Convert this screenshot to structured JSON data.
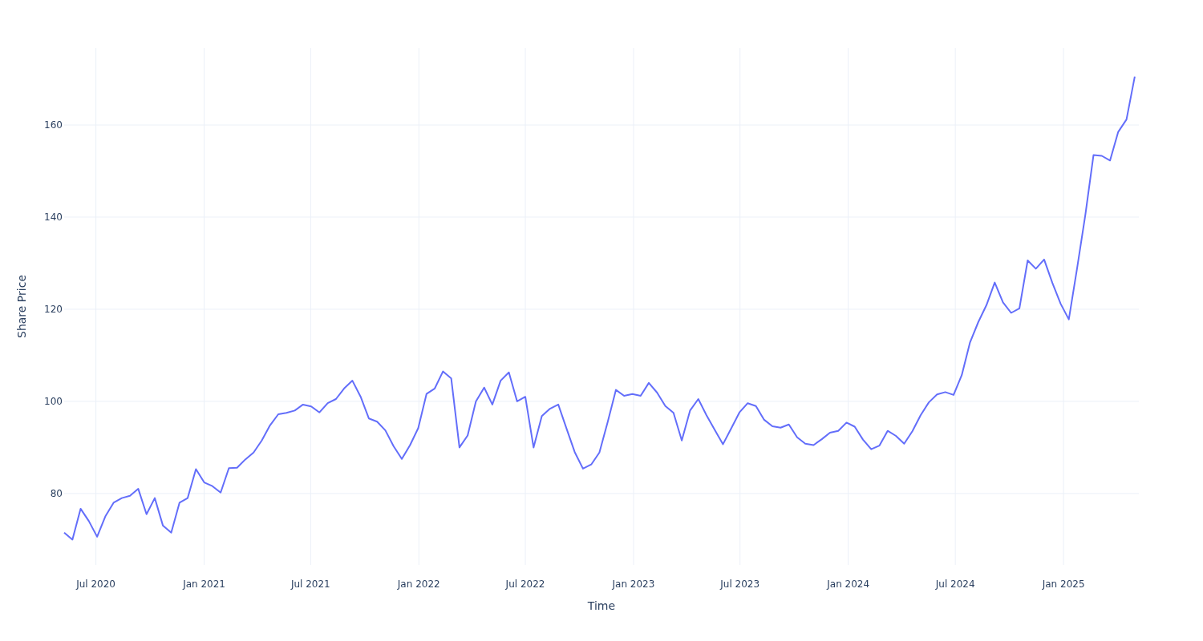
{
  "chart": {
    "chart_data": {
      "type": "line",
      "xlabel": "Time",
      "ylabel": "Share Price",
      "grid": true,
      "xlim": [
        "2020-05-08",
        "2025-05-09"
      ],
      "ylim": [
        64.5,
        176.7
      ],
      "xticks": [
        {
          "value": "2020-07-01",
          "label": "Jul 2020"
        },
        {
          "value": "2021-01-01",
          "label": "Jan 2021"
        },
        {
          "value": "2021-07-01",
          "label": "Jul 2021"
        },
        {
          "value": "2022-01-01",
          "label": "Jan 2022"
        },
        {
          "value": "2022-07-01",
          "label": "Jul 2022"
        },
        {
          "value": "2023-01-01",
          "label": "Jan 2023"
        },
        {
          "value": "2023-07-01",
          "label": "Jul 2023"
        },
        {
          "value": "2024-01-01",
          "label": "Jan 2024"
        },
        {
          "value": "2024-07-01",
          "label": "Jul 2024"
        },
        {
          "value": "2025-01-01",
          "label": "Jan 2025"
        }
      ],
      "yticks": [
        80,
        100,
        120,
        140,
        160
      ],
      "x": [
        "2020-05-08",
        "2020-05-22",
        "2020-06-05",
        "2020-06-19",
        "2020-07-03",
        "2020-07-17",
        "2020-07-31",
        "2020-08-14",
        "2020-08-28",
        "2020-09-11",
        "2020-09-25",
        "2020-10-09",
        "2020-10-23",
        "2020-11-06",
        "2020-11-20",
        "2020-12-04",
        "2020-12-18",
        "2021-01-01",
        "2021-01-15",
        "2021-01-29",
        "2021-02-12",
        "2021-02-26",
        "2021-03-12",
        "2021-03-26",
        "2021-04-09",
        "2021-04-23",
        "2021-05-07",
        "2021-05-21",
        "2021-06-04",
        "2021-06-18",
        "2021-07-02",
        "2021-07-16",
        "2021-07-30",
        "2021-08-13",
        "2021-08-27",
        "2021-09-10",
        "2021-09-24",
        "2021-10-08",
        "2021-10-22",
        "2021-11-05",
        "2021-11-19",
        "2021-12-03",
        "2021-12-17",
        "2021-12-31",
        "2022-01-14",
        "2022-01-28",
        "2022-02-11",
        "2022-02-25",
        "2022-03-11",
        "2022-03-25",
        "2022-04-08",
        "2022-04-22",
        "2022-05-06",
        "2022-05-20",
        "2022-06-03",
        "2022-06-17",
        "2022-07-01",
        "2022-07-15",
        "2022-07-29",
        "2022-08-12",
        "2022-08-26",
        "2022-09-09",
        "2022-09-23",
        "2022-10-07",
        "2022-10-21",
        "2022-11-04",
        "2022-11-18",
        "2022-12-02",
        "2022-12-16",
        "2022-12-30",
        "2023-01-13",
        "2023-01-27",
        "2023-02-10",
        "2023-02-24",
        "2023-03-10",
        "2023-03-24",
        "2023-04-07",
        "2023-04-21",
        "2023-05-05",
        "2023-05-19",
        "2023-06-02",
        "2023-06-16",
        "2023-06-30",
        "2023-07-14",
        "2023-07-28",
        "2023-08-11",
        "2023-08-25",
        "2023-09-08",
        "2023-09-22",
        "2023-10-06",
        "2023-10-20",
        "2023-11-03",
        "2023-11-17",
        "2023-12-01",
        "2023-12-15",
        "2023-12-29",
        "2024-01-12",
        "2024-01-26",
        "2024-02-09",
        "2024-02-23",
        "2024-03-08",
        "2024-03-22",
        "2024-04-05",
        "2024-04-19",
        "2024-05-03",
        "2024-05-17",
        "2024-05-31",
        "2024-06-14",
        "2024-06-28",
        "2024-07-12",
        "2024-07-26",
        "2024-08-09",
        "2024-08-23",
        "2024-09-06",
        "2024-09-20",
        "2024-10-04",
        "2024-10-18",
        "2024-11-01",
        "2024-11-15",
        "2024-11-29",
        "2024-12-13",
        "2024-12-27",
        "2025-01-10",
        "2025-01-24",
        "2025-02-07",
        "2025-02-21",
        "2025-03-07",
        "2025-03-21",
        "2025-04-04",
        "2025-04-18",
        "2025-05-02"
      ],
      "series": [
        {
          "color": "#636efa",
          "values": [
            71.5,
            70,
            76.7,
            74,
            70.6,
            75,
            78,
            79,
            79.5,
            81,
            75.5,
            79,
            73,
            71.5,
            78,
            79,
            85.3,
            82.4,
            81.6,
            80.2,
            85.5,
            85.6,
            87.4,
            88.9,
            91.5,
            94.8,
            97.2,
            97.5,
            98,
            99.3,
            98.9,
            97.6,
            99.6,
            100.5,
            102.8,
            104.5,
            101,
            96.3,
            95.6,
            93.7,
            90.3,
            87.5,
            90.5,
            94.2,
            101.6,
            102.8,
            106.5,
            105,
            90,
            92.6,
            100,
            103,
            99.3,
            104.5,
            106.3,
            100,
            101,
            90,
            96.8,
            98.4,
            99.3,
            94.1,
            89,
            85.4,
            86.3,
            88.9,
            95.5,
            102.5,
            101.2,
            101.6,
            101.2,
            104,
            101.9,
            99,
            97.5,
            91.5,
            98,
            100.5,
            97,
            93.8,
            90.7,
            94.1,
            97.6,
            99.6,
            99,
            96,
            94.6,
            94.3,
            95,
            92.2,
            90.8,
            90.5,
            91.8,
            93.2,
            93.6,
            95.4,
            94.5,
            91.7,
            89.6,
            90.4,
            93.6,
            92.5,
            90.8,
            93.5,
            97,
            99.8,
            101.5,
            102,
            101.4,
            105.7,
            112.8,
            117.2,
            120.9,
            125.8,
            121.5,
            119.2,
            120.2,
            130.6,
            128.8,
            130.8,
            125.7,
            121.2,
            117.8,
            128.9,
            140.5,
            153.5,
            153.3,
            152.3,
            158.5,
            161.2,
            170.5
          ]
        }
      ]
    }
  }
}
